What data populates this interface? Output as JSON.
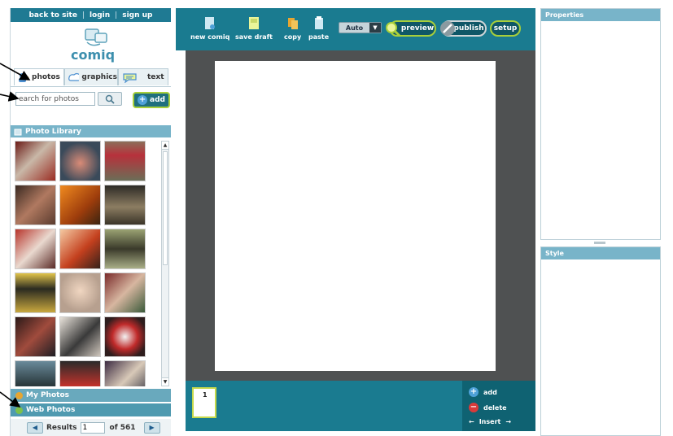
{
  "topnav": {
    "back_to_site": "back to site",
    "sep": "|",
    "login": "login",
    "sign_up": "sign up"
  },
  "logo": {
    "text": "comiq",
    "icon": "comiq-logo"
  },
  "tabs": [
    {
      "label": "photos",
      "icon": "person-photo-icon"
    },
    {
      "label": "graphics",
      "icon": "cloud-icon"
    },
    {
      "label": "text",
      "icon": "speech-bubble-icon"
    }
  ],
  "search": {
    "placeholder": "Search for photos",
    "value": "earch for photos",
    "button_icon": "magnifier-icon"
  },
  "add_button": {
    "label": "add",
    "icon": "plus-icon"
  },
  "library": {
    "title": "Photo Library"
  },
  "sections": {
    "my_photos": "My Photos",
    "web_photos": "Web Photos"
  },
  "pager": {
    "results_label": "Results",
    "page": "1",
    "of_label": "of 561"
  },
  "toolbar": {
    "new_comiq": "new comiq",
    "save_draft": "save draft",
    "copy": "copy",
    "paste": "paste",
    "auto": "Auto",
    "preview": "preview",
    "publish": "publish",
    "setup": "setup"
  },
  "filmstrip": {
    "frame_number": "1",
    "add": "add",
    "delete": "delete",
    "insert": "Insert"
  },
  "panels": {
    "properties": "Properties",
    "style": "Style"
  },
  "colors": {
    "teal": "#1a7b90",
    "light_teal": "#78b4c9",
    "accent_green": "#a8cf3a",
    "workspace_gray": "#4f5152"
  }
}
